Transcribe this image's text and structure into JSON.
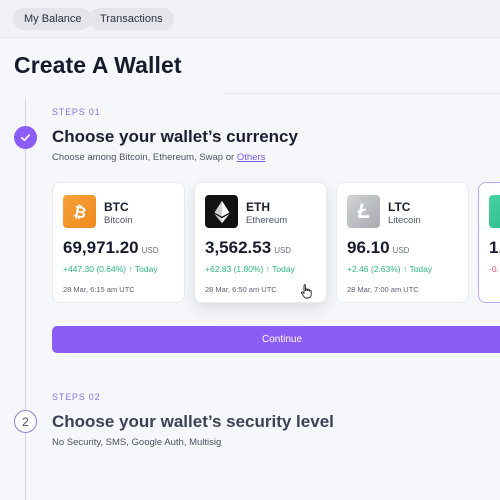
{
  "topbar": {
    "tabs": [
      {
        "label": "My Balance"
      },
      {
        "label": "Transactions"
      }
    ]
  },
  "page_title": "Create A Wallet",
  "step1": {
    "label": "STEPS  01",
    "heading": "Choose your wallet’s currency",
    "description_prefix": "Choose among Bitcoin, Ethereum, Swap or ",
    "description_link": "Others",
    "status": "completed"
  },
  "cards": [
    {
      "symbol": "BTC",
      "name": "Bitcoin",
      "price": "69,971.20",
      "currency": "USD",
      "change": "+447.30 (0.64%) ↑ Today",
      "date": "28 Mar, 6:15 am UTC",
      "icon": "bitcoin-icon"
    },
    {
      "symbol": "ETH",
      "name": "Ethereum",
      "price": "3,562.53",
      "currency": "USD",
      "change": "+62.83 (1.80%) ↑ Today",
      "date": "28 Mar, 6:50 am UTC",
      "icon": "ethereum-icon"
    },
    {
      "symbol": "LTC",
      "name": "Litecoin",
      "price": "96.10",
      "currency": "USD",
      "change": "+2.46 (2.63%) ↑ Today",
      "date": "28 Mar, 7:00 am UTC",
      "icon": "litecoin-icon"
    }
  ],
  "partial_card": {
    "price": "1.",
    "change": "-0.",
    "icon": "coin-icon"
  },
  "continue_label": "Continue",
  "step2": {
    "label": "STEPS  02",
    "number": "2",
    "heading": "Choose your wallet’s security level",
    "description": "No Security, SMS, Google Auth, Multisig"
  },
  "colors": {
    "accent": "#8b5cf6",
    "positive": "#2eb67d",
    "negative": "#e0506e",
    "btc": "#f7931a",
    "eth": "#121212",
    "ltc": "#b8b8bd"
  }
}
